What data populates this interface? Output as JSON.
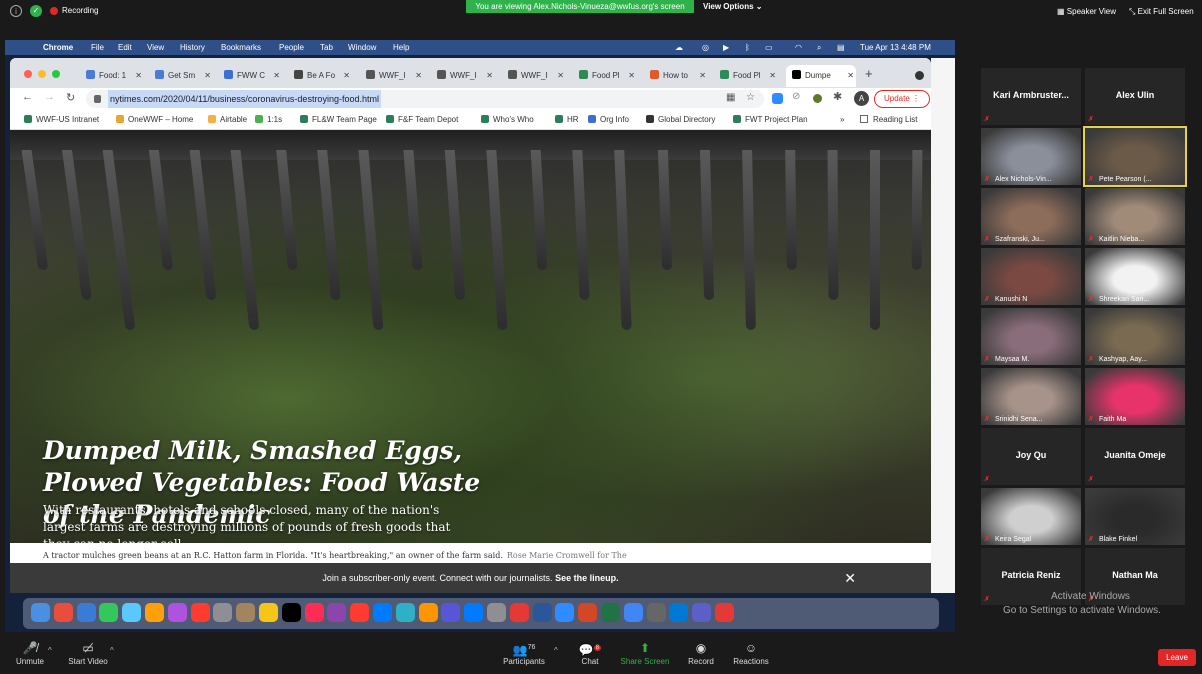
{
  "zoom_top": {
    "recording_label": "Recording",
    "share_banner": "You are viewing Alex.Nichols-Vinueza@wwfus.org's screen",
    "view_options": "View Options ⌄",
    "speaker_view": "Speaker View",
    "exit_full_screen": "Exit Full Screen"
  },
  "mac_menubar": {
    "app": "Chrome",
    "menus": [
      "File",
      "Edit",
      "View",
      "History",
      "Bookmarks",
      "People",
      "Tab",
      "Window",
      "Help"
    ],
    "clock": "Tue Apr 13  4:48 PM"
  },
  "tabs": [
    {
      "label": "Food: 1",
      "color": "#4a7bd6"
    },
    {
      "label": "Get Sm",
      "color": "#4a7bd6"
    },
    {
      "label": "FWW C",
      "color": "#3b6fd4"
    },
    {
      "label": "Be A Fo",
      "color": "#444444"
    },
    {
      "label": "WWF_I",
      "color": "#555555"
    },
    {
      "label": "WWF_I",
      "color": "#555555"
    },
    {
      "label": "WWF_I",
      "color": "#555555"
    },
    {
      "label": "Food Pl",
      "color": "#2e8b57"
    },
    {
      "label": "How to",
      "color": "#e05a2a"
    },
    {
      "label": "Food Pl",
      "color": "#2e8b57"
    },
    {
      "label": "Dumpe",
      "color": "#000000"
    }
  ],
  "address_bar": {
    "url": "nytimes.com/2020/04/11/business/coronavirus-destroying-food.html",
    "update_label": "Update",
    "profile_initial": "A"
  },
  "bookmarks": [
    {
      "label": "WWF-US Intranet",
      "color": "#2e7d5a"
    },
    {
      "label": "OneWWF – Home",
      "color": "#e8a530"
    },
    {
      "label": "Airtable",
      "color": "#f5b041"
    },
    {
      "label": "1:1s",
      "color": "#4caf50"
    },
    {
      "label": "FL&W Team Page",
      "color": "#2e7d5a"
    },
    {
      "label": "F&F Team Depot",
      "color": "#2e7d5a"
    },
    {
      "label": "Who's Who",
      "color": "#2e7d5a"
    },
    {
      "label": "HR",
      "color": "#2e7d5a"
    },
    {
      "label": "Org Info",
      "color": "#3b6fd4"
    },
    {
      "label": "Global Directory",
      "color": "#333333"
    },
    {
      "label": "FWT Project Plan",
      "color": "#2e7d5a"
    }
  ],
  "reading_list": "Reading List",
  "article": {
    "headline": "Dumped Milk, Smashed Eggs, Plowed Vegetables: Food Waste of the Pandemic",
    "dek": "With restaurants, hotels and schools closed, many of the nation's largest farms are destroying millions of pounds of fresh goods that they can no longer sell.",
    "caption": "A tractor mulches green beans at an R.C. Hatton farm in Florida. \"It's heartbreaking,\" an owner of the farm said.",
    "credit": "Rose Marie Cromwell for The",
    "subscriber_banner": "Join a subscriber-only event. Connect with our journalists.",
    "subscriber_link": "See the lineup."
  },
  "dock_colors": [
    "#4a90e2",
    "#e94e3c",
    "#3a7bd5",
    "#34c759",
    "#5ac8fa",
    "#ff9f0a",
    "#af52de",
    "#ff3b30",
    "#8e8e93",
    "#a2845e",
    "#f5c518",
    "#000000",
    "#ff2d55",
    "#8e44ad",
    "#ff3b30",
    "#007aff",
    "#30b0c7",
    "#ff9500",
    "#5856d6",
    "#007aff",
    "#8e8e93",
    "#e53935",
    "#2b579a",
    "#2d8cff",
    "#d24726",
    "#217346",
    "#4285f4",
    "#666666",
    "#0078d4",
    "#5b5fc7",
    "#e53935"
  ],
  "participants": [
    {
      "name": "Kari Armbruster...",
      "video": false,
      "color": ""
    },
    {
      "name": "Alex Ulin",
      "video": false,
      "color": ""
    },
    {
      "name": "Alex Nichols-Vin...",
      "video": true,
      "color": "#8a8f9a"
    },
    {
      "name": "Pete Pearson (...",
      "video": true,
      "color": "#6b5a48",
      "active": true
    },
    {
      "name": "Szafranski, Ju...",
      "video": true,
      "color": "#8c6c5a"
    },
    {
      "name": "Kaitlin Nieba...",
      "video": true,
      "color": "#a08a78"
    },
    {
      "name": "Kanushi N",
      "video": true,
      "color": "#7a4a42"
    },
    {
      "name": "Shreekari Sari...",
      "video": true,
      "color": "#f2f2f2"
    },
    {
      "name": "Maysaa M.",
      "video": true,
      "color": "#8a6d7a"
    },
    {
      "name": "Kashyap, Aay...",
      "video": true,
      "color": "#7a6a52"
    },
    {
      "name": "Srinidhi Sena...",
      "video": true,
      "color": "#a8938a"
    },
    {
      "name": "Faith Ma",
      "video": true,
      "color": "#e8336a"
    },
    {
      "name": "Joy Qu",
      "video": false,
      "color": ""
    },
    {
      "name": "Juanita Omeje",
      "video": false,
      "color": ""
    },
    {
      "name": "Keira Segal",
      "video": true,
      "color": "#cfcfcf"
    },
    {
      "name": "Blake Finkel",
      "video": true,
      "color": "#2a2a2a"
    },
    {
      "name": "Patricia Reniz",
      "video": false,
      "color": ""
    },
    {
      "name": "Nathan Ma",
      "video": false,
      "color": ""
    }
  ],
  "windows_watermark": {
    "line1": "Activate Windows",
    "line2": "Go to Settings to activate Windows."
  },
  "toolbar": {
    "unmute": "Unmute",
    "start_video": "Start Video",
    "participants": "Participants",
    "participant_count": "76",
    "chat": "Chat",
    "chat_badge": "8",
    "share_screen": "Share Screen",
    "record": "Record",
    "reactions": "Reactions",
    "leave": "Leave"
  }
}
